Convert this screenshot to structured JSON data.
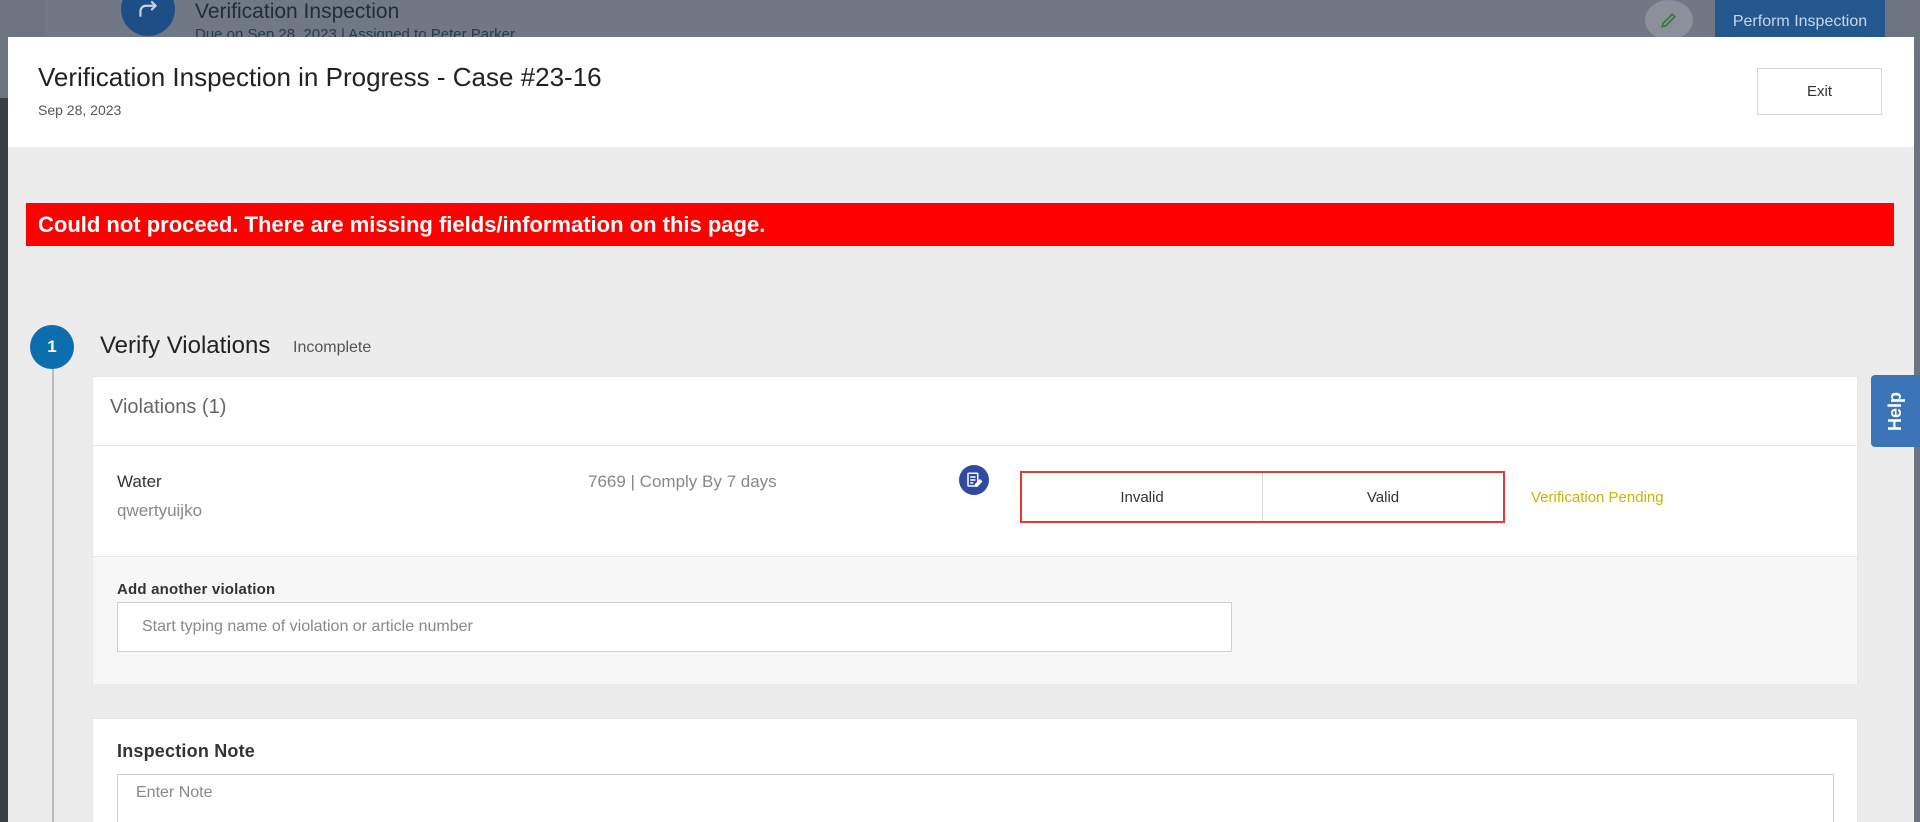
{
  "background": {
    "title": "Verification Inspection",
    "subtitle": "Due on Sep 28, 2023 | Assigned to Peter Parker",
    "perform_button": "Perform Inspection",
    "icons": [
      "redo-arrow-icon",
      "pencil-icon"
    ]
  },
  "modal": {
    "title": "Verification Inspection in Progress - Case #23-16",
    "date": "Sep 28, 2023",
    "exit_label": "Exit"
  },
  "error_banner": "Could not proceed. There are missing fields/information on this page.",
  "step": {
    "number": "1",
    "title": "Verify Violations",
    "status": "Incomplete"
  },
  "violations": {
    "title": "Violations (1)",
    "items": [
      {
        "name": "Water",
        "description": "qwertyuijko",
        "code_info": "7669 | Comply By 7 days",
        "options": [
          "Invalid",
          "Valid"
        ],
        "status": "Verification Pending"
      }
    ],
    "add_label": "Add another violation",
    "add_placeholder": "Start typing name of violation or article number"
  },
  "inspection_note": {
    "label": "Inspection Note",
    "placeholder": "Enter Note"
  },
  "help_label": "Help",
  "colors": {
    "error": "#ff0000",
    "step_accent": "#0d6ead",
    "toggle_border": "#e53935",
    "pending_status": "#c9b400",
    "help_tab": "#3b74b7"
  }
}
